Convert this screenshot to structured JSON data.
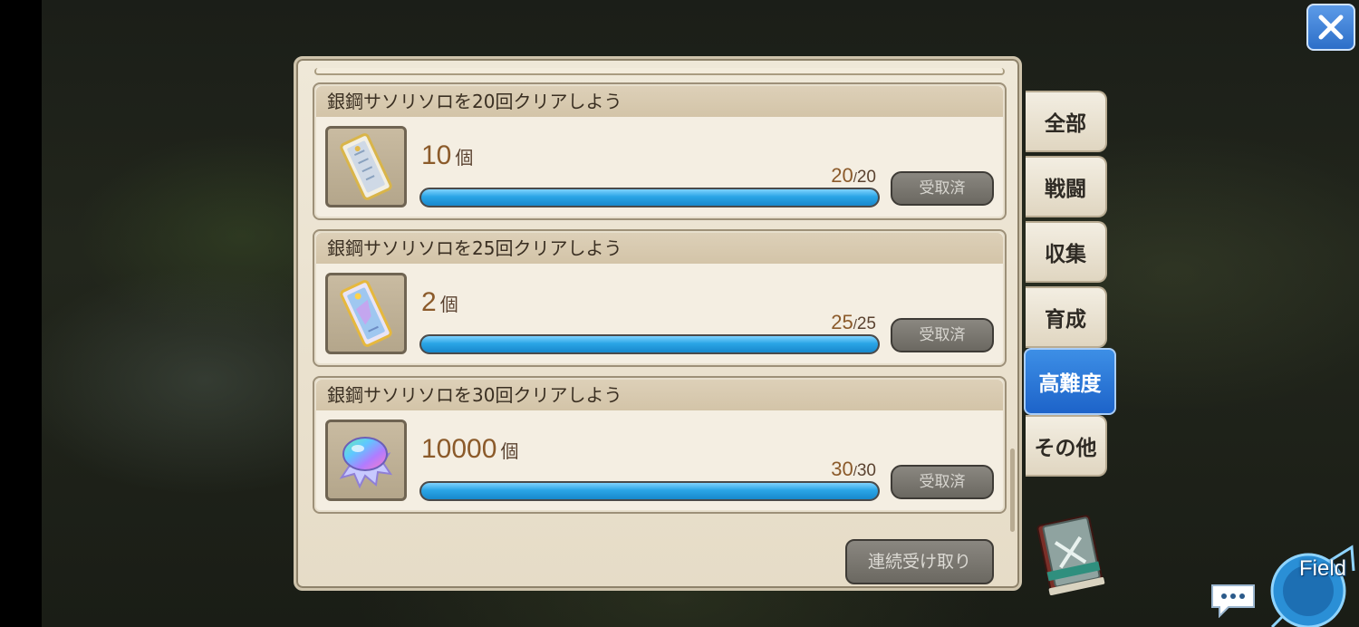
{
  "close_label": "✕",
  "missions": [
    {
      "title": "銀鋼サソリソロを20回クリアしよう",
      "reward_icon": "ticket-icon",
      "reward_count": "10",
      "reward_unit": "個",
      "progress_current": "20",
      "progress_sep": "/",
      "progress_total": "20",
      "progress_fraction": 1.0,
      "claim_label": "受取済"
    },
    {
      "title": "銀鋼サソリソロを25回クリアしよう",
      "reward_icon": "rare-ticket-icon",
      "reward_count": "2",
      "reward_unit": "個",
      "progress_current": "25",
      "progress_sep": "/",
      "progress_total": "25",
      "progress_fraction": 1.0,
      "claim_label": "受取済"
    },
    {
      "title": "銀鋼サソリソロを30回クリアしよう",
      "reward_icon": "rainbow-crystal-icon",
      "reward_count": "10000",
      "reward_unit": "個",
      "progress_current": "30",
      "progress_sep": "/",
      "progress_total": "30",
      "progress_fraction": 1.0,
      "claim_label": "受取済"
    }
  ],
  "bulk_claim_label": "連続受け取り",
  "tabs": [
    {
      "label": "全部",
      "active": false
    },
    {
      "label": "戦闘",
      "active": false
    },
    {
      "label": "収集",
      "active": false
    },
    {
      "label": "育成",
      "active": false
    },
    {
      "label": "高難度",
      "active": true
    },
    {
      "label": "その他",
      "active": false
    }
  ],
  "field_label": "Field",
  "colors": {
    "accent_blue": "#1d63c9",
    "progress_blue": "#2aa5e6",
    "count_brown": "#8b5a2a",
    "panel_bg": "#efe8d8"
  }
}
